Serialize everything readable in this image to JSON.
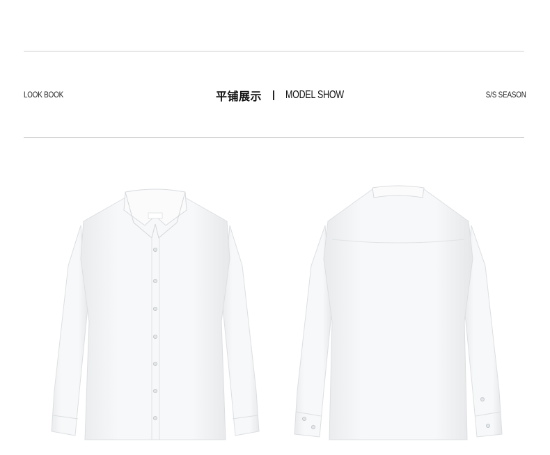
{
  "header": {
    "left_label": "LOOK BOOK",
    "title_cn": "平铺展示",
    "title_en": "MODEL SHOW",
    "right_label": "S/S SEASON"
  },
  "images": {
    "front": {
      "label": "white-shirt-front-icon"
    },
    "back": {
      "label": "white-shirt-back-icon"
    }
  },
  "colors": {
    "background": "#ffffff",
    "rule": "#cfcfcf",
    "text": "#1a1a1a",
    "shirt": "#f4f5f6"
  }
}
